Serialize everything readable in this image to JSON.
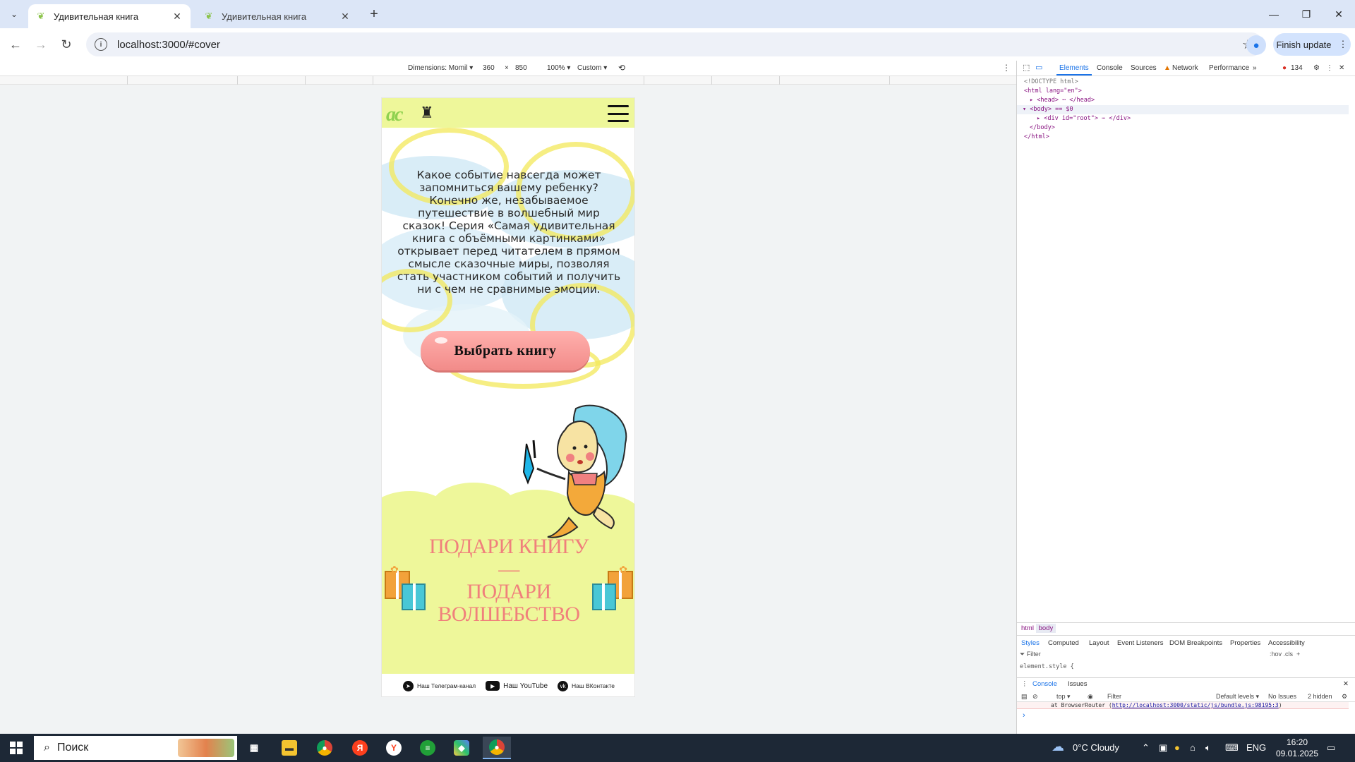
{
  "browser": {
    "tabs": [
      {
        "title": "Удивительная книга",
        "active": true
      },
      {
        "title": "Удивительная книга",
        "active": false
      }
    ],
    "url": "localhost:3000/#cover",
    "finish_update": "Finish update"
  },
  "device_toolbar": {
    "dimensions": "Dimensions: Momil ▾",
    "width": "360",
    "times": "×",
    "height": "850",
    "zoom": "100% ▾",
    "throttle": "Custom ▾"
  },
  "page": {
    "intro_text": "Какое событие навсегда может запомниться вашему ребенку? Конечно же, незабываемое путешествие в волшебный мир сказок! Серия «Самая удивительная книга с объёмными картинками» открывает перед читателем в прямом смысле сказочные миры, позволяя стать участником событий и получить ни с чем не сравнимые эмоции.",
    "cta_label": "Выбрать книгу",
    "slogan_line1": "ПОДАРИ КНИГУ —",
    "slogan_line2": "ПОДАРИ",
    "slogan_line3": "ВОЛШЕБСТВО",
    "logo_text": "ас",
    "footer": {
      "telegram": "Наш Телеграм-канал",
      "youtube": "Наш YouTube",
      "vk": "Наш ВКонтакте"
    }
  },
  "devtools": {
    "tabs": [
      "Elements",
      "Console",
      "Sources",
      "Network",
      "Performance"
    ],
    "active_tab": "Elements",
    "error_count": "134",
    "dom_lines": {
      "doctype": "<!DOCTYPE html>",
      "html_open": "<html lang=\"en\">",
      "head": "<head> ⋯ </head>",
      "body_open": "<body> == $0",
      "div_root": "<div id=\"root\"> ⋯ </div>",
      "body_close": "</body>",
      "html_close": "</html>"
    },
    "breadcrumbs": [
      "html",
      "body"
    ],
    "styles_tabs": [
      "Styles",
      "Computed",
      "Layout",
      "Event Listeners",
      "DOM Breakpoints",
      "Properties",
      "Accessibility"
    ],
    "filter_placeholder": "Filter",
    "hov_cls": ":hov  .cls",
    "element_style": "element.style {",
    "console_tabs": [
      "Console",
      "Issues"
    ],
    "console_context": "top ▾",
    "console_filter": "Filter",
    "default_levels": "Default levels ▾",
    "no_issues": "No Issues",
    "hidden": "2 hidden",
    "console_error_prefix": "at BrowserRouter (",
    "console_error_link": "http://localhost:3000/static/js/bundle.js:98195:3",
    "console_error_suffix": ")"
  },
  "taskbar": {
    "search_placeholder": "Поиск",
    "weather": "0°C  Cloudy",
    "lang": "ENG",
    "time": "16:20",
    "date": "09.01.2025"
  },
  "colors": {
    "accent_yellow": "#eef79a",
    "cta_pink": "#f28b89",
    "slogan_pink": "#f0807c",
    "devtools_blue": "#1a73e8"
  }
}
